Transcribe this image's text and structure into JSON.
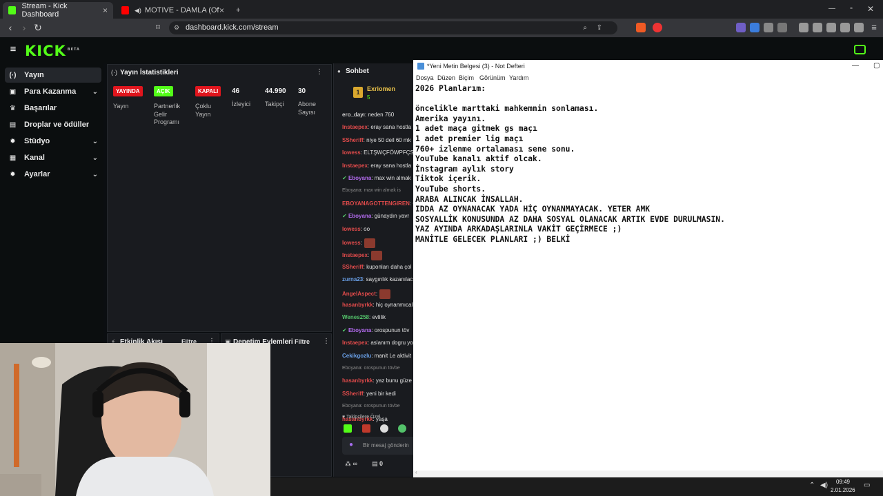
{
  "browser": {
    "tabs": [
      {
        "label": "Stream - Kick Dashboard",
        "close": "×"
      },
      {
        "label": "MOTIVE - DAMLA (Official Audio)",
        "close": "×"
      }
    ],
    "new_tab": "+",
    "url": "dashboard.kick.com/stream"
  },
  "kick": {
    "logo": "KICK",
    "logo_badge": "BETA"
  },
  "sidebar": {
    "items": [
      {
        "label": "Yayın",
        "icon": "broadcast-icon",
        "glyph": "(·)",
        "expand": false
      },
      {
        "label": "Para Kazanma",
        "icon": "money-icon",
        "glyph": "▣",
        "expand": true
      },
      {
        "label": "Başarılar",
        "icon": "trophy-icon",
        "glyph": "♛",
        "expand": false
      },
      {
        "label": "Droplar ve ödüller",
        "icon": "gift-icon",
        "glyph": "▤",
        "expand": false
      },
      {
        "label": "Stüdyo",
        "icon": "studio-icon",
        "glyph": "✹",
        "expand": true
      },
      {
        "label": "Kanal",
        "icon": "channel-icon",
        "glyph": "▦",
        "expand": true
      },
      {
        "label": "Ayarlar",
        "icon": "gear-icon",
        "glyph": "✹",
        "expand": true
      }
    ]
  },
  "stats": {
    "title": "Yayın İstatistikleri",
    "badges": [
      {
        "text": "YAYINDA",
        "color": "#e1151d",
        "label_lines": [
          "Yayın"
        ]
      },
      {
        "text": "AÇIK",
        "color": "#53fc18",
        "label_lines": [
          "Partnerlik",
          "Gelir",
          "Programı"
        ]
      },
      {
        "text": "KAPALI",
        "color": "#e1151d",
        "label_lines": [
          "Çoklu",
          "Yayın"
        ]
      }
    ],
    "numbers": [
      {
        "value": "46",
        "label_lines": [
          "İzleyici"
        ]
      },
      {
        "value": "44.990",
        "label_lines": [
          "Takipçi"
        ]
      },
      {
        "value": "30",
        "label_lines": [
          "Abone",
          "Sayısı"
        ]
      }
    ]
  },
  "activity": {
    "title": "Etkinlik Akışı",
    "filter": "Filtre"
  },
  "moderation": {
    "title": "Denetim Eylemleri",
    "filter": "Filtre"
  },
  "chat": {
    "title": "Sohbet",
    "pinned_user": "Exriomen",
    "pinned_sub": "5",
    "lines": [
      {
        "user": "ero_dayı",
        "text": ": neden 760",
        "color": "#d0d0d0"
      },
      {
        "user": "Instaepex",
        "text": ": eray sana hostla",
        "color": "#e14b4b"
      },
      {
        "user": "SSheriff",
        "text": ": niye 50 deil 60 mk",
        "color": "#e14b4b"
      },
      {
        "user": "Iowess",
        "text": ": ELTŞWÇFÖWPFÇS",
        "color": "#e14b4b"
      },
      {
        "user": "Instaepex",
        "text": ": eray sana hostla",
        "color": "#e14b4b"
      },
      {
        "user": "Eboyana",
        "text": ": max win almak",
        "color": "#b46cf0"
      },
      {
        "sys": "Eboyana: max win almak is"
      },
      {
        "user": "EBOYANAGOTTENGIREN",
        "text": ": G",
        "color": "#e14b4b"
      },
      {
        "user": "Eboyana",
        "text": ": günaydın yavr",
        "color": "#b46cf0"
      },
      {
        "user": "Iowess",
        "text": ": oo",
        "color": "#e14b4b"
      },
      {
        "user": "Iowess",
        "text": ":",
        "color": "#e14b4b",
        "emote": true
      },
      {
        "user": "Instaepex",
        "text": ":",
        "color": "#e14b4b",
        "emote": true
      },
      {
        "user": "SSheriff",
        "text": ": kuponları daha çol",
        "color": "#e14b4b"
      },
      {
        "user": "zurna23",
        "text": ": saygınlık kazanılac",
        "color": "#6aa0e8"
      },
      {
        "user": "AngelAspect",
        "text": ":",
        "color": "#e14b4b",
        "emote": true
      },
      {
        "user": "hasanbyrkk",
        "text": ": hiç oynanmıcal",
        "color": "#e14b4b"
      },
      {
        "user": "Wenes258",
        "text": ": evlilik",
        "color": "#53c26a"
      },
      {
        "user": "Eboyana",
        "text": ": orospunun töv",
        "color": "#b46cf0"
      },
      {
        "user": "Instaepex",
        "text": ": aslanım dogru yo",
        "color": "#e14b4b"
      },
      {
        "user": "Cekikgozlu",
        "text": ": manit Le aktivit",
        "color": "#6aa0e8"
      },
      {
        "sys": "Eboyana: orospunun tövbe"
      },
      {
        "user": "hasanbyrkk",
        "text": ": yaz bunu güze",
        "color": "#e14b4b"
      },
      {
        "user": "SSheriff",
        "text": ": yeni bir kedi",
        "color": "#e14b4b"
      },
      {
        "sys": "Eboyana: orospunun tövbe"
      },
      {
        "user": "hasanbyrkk",
        "text": ": yaşa",
        "color": "#e14b4b"
      }
    ],
    "followers_only": "Takipçilere Özel",
    "input_placeholder": "Bir mesaj gönderin",
    "bottom_count": "0",
    "bottom_infinity": "∞"
  },
  "notepad": {
    "title": "*Yeni Metin Belgesi (3) - Not Defteri",
    "menu": [
      "Dosya",
      "Düzen",
      "Biçim",
      "Görünüm",
      "Yardım"
    ],
    "lines": [
      "2026 Planlarım:",
      "",
      "öncelikle marttaki mahkemnin sonlaması.",
      "Amerika yayını.",
      "1 adet maça gitmek gs maçı",
      "1 adet premier lig maçı",
      "760+ izlenme ortalaması sene sonu.",
      "YouTube kanalı aktif olcak.",
      "İnstagram aylık story",
      "Tiktok içerik.",
      "YouTube shorts.",
      "ARABA ALINCAK İNSALLAH.",
      "IDDA AZ OYNANACAK YADA HİÇ OYNANMAYACAK. YETER AMK",
      "SOSYALLİK KONUSUNDA AZ DAHA SOSYAL OLANACAK ARTIK EVDE DURULMASIN.",
      "YAZ AYINDA ARKADAŞLARINLA VAKİT GEÇİRMECE ;)",
      "MANİTLE GELECEK PLANLARI ;) BELKİ"
    ]
  },
  "taskbar": {
    "time": "09:49",
    "date": "2.01.2026"
  },
  "colors": {
    "kick_green": "#53fc18",
    "live_red": "#e1151d"
  }
}
